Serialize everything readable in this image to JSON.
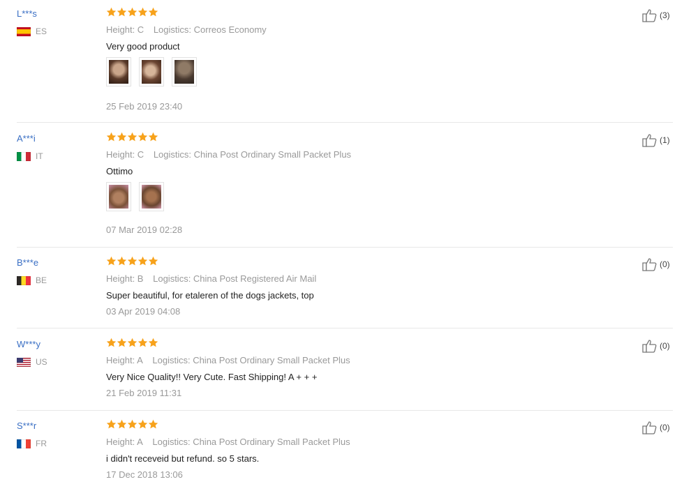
{
  "reviews": [
    {
      "user": "L***s",
      "country": "ES",
      "height": "Height: C",
      "logistics": "Logistics: Correos Economy",
      "text": "Very good product",
      "date": "25 Feb 2019 23:40",
      "helpful": "(3)",
      "rating": 5,
      "photos": [
        "photo-dog-1",
        "photo-dog-2",
        "photo-dog-3"
      ]
    },
    {
      "user": "A***i",
      "country": "IT",
      "height": "Height: C",
      "logistics": "Logistics: China Post Ordinary Small Packet Plus",
      "text": "Ottimo",
      "date": "07 Mar 2019 02:28",
      "helpful": "(1)",
      "rating": 5,
      "photos": [
        "photo-dog-4",
        "photo-dog-5"
      ]
    },
    {
      "user": "B***e",
      "country": "BE",
      "height": "Height: B",
      "logistics": "Logistics: China Post Registered Air Mail",
      "text": "Super beautiful, for etaleren of the dogs jackets, top",
      "date": "03 Apr 2019 04:08",
      "helpful": "(0)",
      "rating": 5,
      "photos": []
    },
    {
      "user": "W***y",
      "country": "US",
      "height": "Height: A",
      "logistics": "Logistics: China Post Ordinary Small Packet Plus",
      "text": "Very Nice Quality!! Very Cute. Fast Shipping! A + + +",
      "date": "21 Feb 2019 11:31",
      "helpful": "(0)",
      "rating": 5,
      "photos": []
    },
    {
      "user": "S***r",
      "country": "FR",
      "height": "Height: A",
      "logistics": "Logistics: China Post Ordinary Small Packet Plus",
      "text": "i didn't receveid but refund. so 5 stars.",
      "date": "17 Dec 2018 13:06",
      "helpful": "(0)",
      "rating": 5,
      "photos": []
    }
  ],
  "colors": {
    "star": "#f7a21b",
    "username": "#3a6fc4",
    "muted": "#999999"
  },
  "icons": {
    "rating": "star-icon",
    "helpful": "thumbs-up-icon"
  }
}
